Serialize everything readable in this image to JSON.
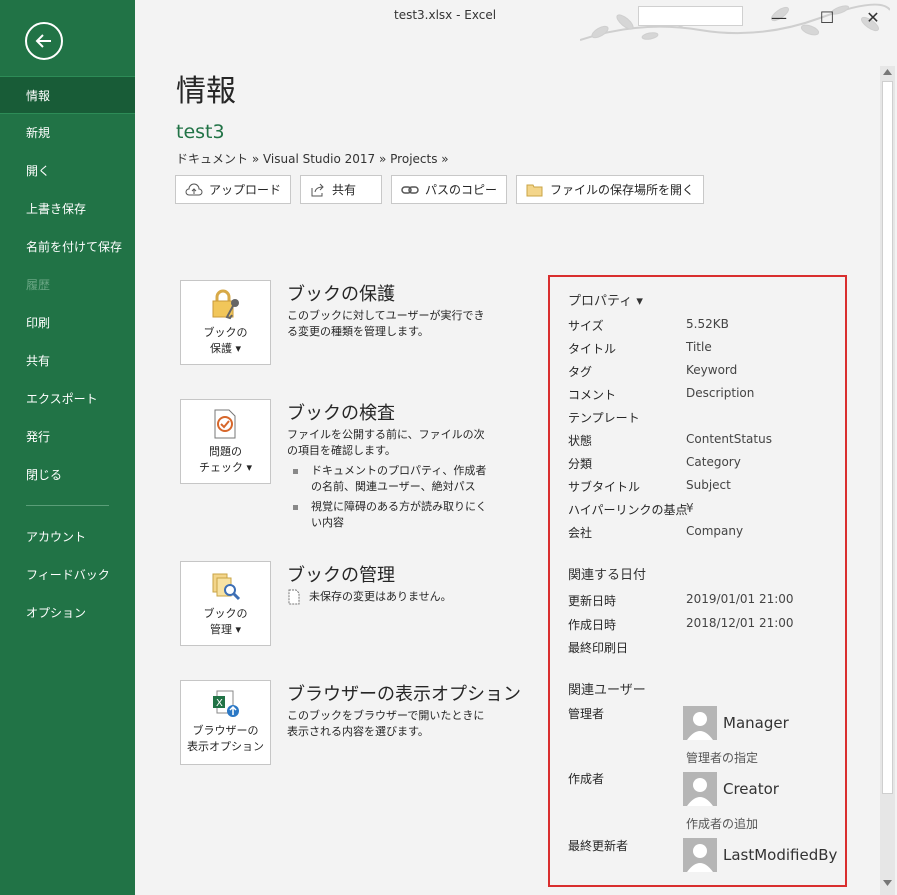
{
  "window": {
    "title": "test3.xlsx  -  Excel",
    "minimize": "—",
    "maximize": "☐",
    "close": "✕"
  },
  "sidebar": {
    "items": [
      {
        "label": "情報"
      },
      {
        "label": "新規"
      },
      {
        "label": "開く"
      },
      {
        "label": "上書き保存"
      },
      {
        "label": "名前を付けて保存"
      },
      {
        "label": "履歴"
      },
      {
        "label": "印刷"
      },
      {
        "label": "共有"
      },
      {
        "label": "エクスポート"
      },
      {
        "label": "発行"
      },
      {
        "label": "閉じる"
      },
      {
        "label": "アカウント"
      },
      {
        "label": "フィードバック"
      },
      {
        "label": "オプション"
      }
    ]
  },
  "main": {
    "title": "情報",
    "file_name": "test3",
    "breadcrumb": "ドキュメント » Visual Studio 2017 » Projects »",
    "actions": {
      "upload": "アップロード",
      "share": "共有",
      "copy_path": "パスのコピー",
      "open_location": "ファイルの保存場所を開く"
    },
    "protect": {
      "button_line1": "ブックの",
      "button_line2": "保護 ▾",
      "title": "ブックの保護",
      "desc": "このブックに対してユーザーが実行できる変更の種類を管理します。"
    },
    "inspect": {
      "button_line1": "問題の",
      "button_line2": "チェック ▾",
      "title": "ブックの検査",
      "desc": "ファイルを公開する前に、ファイルの次の項目を確認します。",
      "bullets": [
        "ドキュメントのプロパティ、作成者の名前、関連ユーザー、絶対パス",
        "視覚に障碍のある方が読み取りにくい内容"
      ]
    },
    "manage": {
      "button_line1": "ブックの",
      "button_line2": "管理 ▾",
      "title": "ブックの管理",
      "desc": "未保存の変更はありません。"
    },
    "browser": {
      "button_line1": "ブラウザーの",
      "button_line2": "表示オプション",
      "title": "ブラウザーの表示オプション",
      "desc": "このブックをブラウザーで開いたときに表示される内容を選びます。"
    }
  },
  "properties": {
    "header": "プロパティ ▾",
    "rows": [
      {
        "key": "サイズ",
        "value": "5.52KB"
      },
      {
        "key": "タイトル",
        "value": "Title"
      },
      {
        "key": "タグ",
        "value": "Keyword"
      },
      {
        "key": "コメント",
        "value": "Description"
      },
      {
        "key": "テンプレート",
        "value": ""
      },
      {
        "key": "状態",
        "value": "ContentStatus"
      },
      {
        "key": "分類",
        "value": "Category"
      },
      {
        "key": "サブタイトル",
        "value": "Subject"
      },
      {
        "key": "ハイパーリンクの基点",
        "value": "¥"
      },
      {
        "key": "会社",
        "value": "Company"
      }
    ],
    "dates_header": "関連する日付",
    "dates": [
      {
        "key": "更新日時",
        "value": "2019/01/01 21:00"
      },
      {
        "key": "作成日時",
        "value": "2018/12/01 21:00"
      },
      {
        "key": "最終印刷日",
        "value": ""
      }
    ],
    "people_header": "関連ユーザー",
    "manager_label": "管理者",
    "manager_name": "Manager",
    "manager_link": "管理者の指定",
    "author_label": "作成者",
    "author_name": "Creator",
    "author_link": "作成者の追加",
    "lastmod_label": "最終更新者",
    "lastmod_name": "LastModifiedBy"
  },
  "colors": {
    "brand": "#217346",
    "highlight_border": "#d92e2e"
  }
}
